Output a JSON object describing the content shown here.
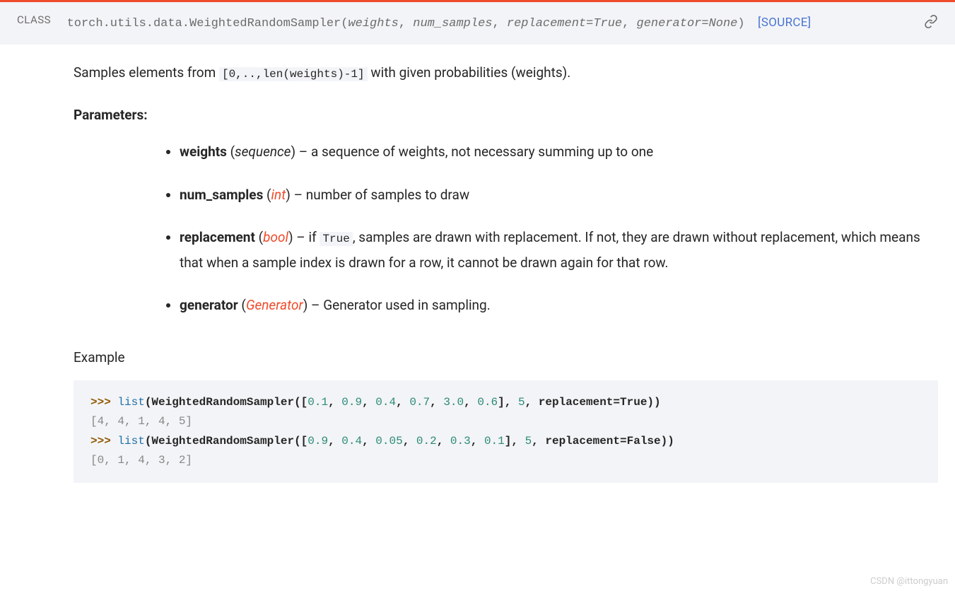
{
  "header": {
    "class_label": "CLASS",
    "qualified_name": "torch.utils.data.WeightedRandomSampler",
    "params": [
      {
        "text": "weights",
        "default": null
      },
      {
        "text": "num_samples",
        "default": null
      },
      {
        "text": "replacement",
        "default": "True"
      },
      {
        "text": "generator",
        "default": "None"
      }
    ],
    "source_link": "[SOURCE]"
  },
  "description": {
    "pre": "Samples elements from ",
    "code": "[0,..,len(weights)-1]",
    "post": " with given probabilities (weights)."
  },
  "parameters_title": "Parameters:",
  "parameters": [
    {
      "name": "weights",
      "type": "sequence",
      "type_is_link": false,
      "desc": "a sequence of weights, not necessary summing up to one"
    },
    {
      "name": "num_samples",
      "type": "int",
      "type_is_link": true,
      "desc": "number of samples to draw"
    },
    {
      "name": "replacement",
      "type": "bool",
      "type_is_link": true,
      "desc_pre": "if ",
      "desc_code": "True",
      "desc_post": ", samples are drawn with replacement. If not, they are drawn without replacement, which means that when a sample index is drawn for a row, it cannot be drawn again for that row."
    },
    {
      "name": "generator",
      "type": "Generator",
      "type_is_link": true,
      "desc": "Generator used in sampling."
    }
  ],
  "example_label": "Example",
  "example": {
    "line1": {
      "prompt": ">>> ",
      "builtin": "list",
      "call": "WeightedRandomSampler",
      "nums": [
        "0.1",
        "0.9",
        "0.4",
        "0.7",
        "3.0",
        "0.6"
      ],
      "arg_int": "5",
      "kw": "replacement",
      "kw_op": "=",
      "kw_val": "True"
    },
    "out1": "[4, 4, 1, 4, 5]",
    "line2": {
      "prompt": ">>> ",
      "builtin": "list",
      "call": "WeightedRandomSampler",
      "nums": [
        "0.9",
        "0.4",
        "0.05",
        "0.2",
        "0.3",
        "0.1"
      ],
      "arg_int": "5",
      "kw": "replacement",
      "kw_op": "=",
      "kw_val": "False"
    },
    "out2": "[0, 1, 4, 3, 2]"
  },
  "watermark": "CSDN @ittongyuan"
}
